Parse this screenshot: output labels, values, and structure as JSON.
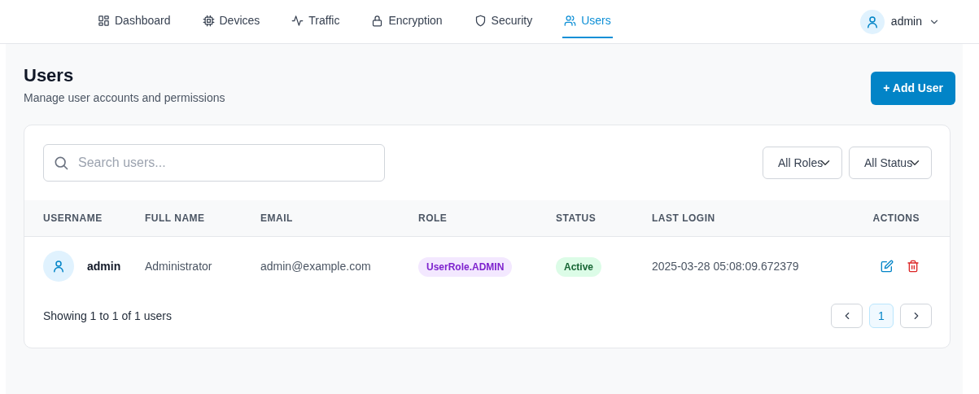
{
  "nav": {
    "tabs": [
      {
        "label": "Dashboard",
        "kind": "grid",
        "selected": false
      },
      {
        "label": "Devices",
        "kind": "chip",
        "selected": false
      },
      {
        "label": "Traffic",
        "kind": "pulse",
        "selected": false
      },
      {
        "label": "Encryption",
        "kind": "lock",
        "selected": false
      },
      {
        "label": "Security",
        "kind": "shield",
        "selected": false
      },
      {
        "label": "Users",
        "kind": "users",
        "selected": true
      }
    ],
    "user": "admin"
  },
  "header": {
    "title": "Users",
    "subtitle": "Manage user accounts and permissions",
    "add_button": "+ Add User"
  },
  "filters": {
    "search_placeholder": "Search users...",
    "role_select": "All Roles",
    "status_select": "All Status"
  },
  "table": {
    "columns": [
      "USERNAME",
      "FULL NAME",
      "EMAIL",
      "ROLE",
      "STATUS",
      "LAST LOGIN",
      "ACTIONS"
    ],
    "rows": [
      {
        "username": "admin",
        "full_name": "Administrator",
        "email": "admin@example.com",
        "role": "UserRole.ADMIN",
        "status": "Active",
        "last_login": "2025-03-28 05:08:09.672379"
      }
    ]
  },
  "footer": {
    "summary": "Showing 1 to 1 of 1 users",
    "pages": [
      {
        "label": "1",
        "selected": true
      }
    ]
  }
}
